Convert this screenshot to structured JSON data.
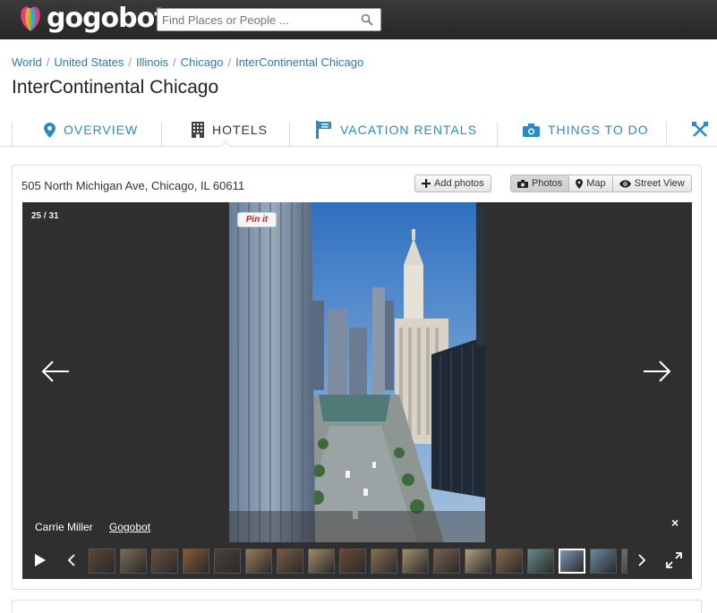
{
  "brand": {
    "name": "gogobot"
  },
  "search": {
    "placeholder": "Find Places or People ..."
  },
  "breadcrumb": [
    "World",
    "United States",
    "Illinois",
    "Chicago",
    "InterContinental Chicago"
  ],
  "page_title": "InterContinental Chicago",
  "tabs": [
    {
      "label": "OVERVIEW",
      "icon": "map-pin-icon",
      "active": false
    },
    {
      "label": "HOTELS",
      "icon": "building-icon",
      "active": true
    },
    {
      "label": "VACATION RENTALS",
      "icon": "flag-icon",
      "active": false
    },
    {
      "label": "THINGS TO DO",
      "icon": "camera-icon",
      "active": false
    }
  ],
  "listing": {
    "address": "505 North Michigan Ave, Chicago, IL 60611",
    "add_photos_label": "Add photos",
    "views": [
      "Photos",
      "Map",
      "Street View"
    ],
    "active_view": "Photos"
  },
  "gallery": {
    "counter": "25 / 31",
    "current": 25,
    "total": 31,
    "pin_label": "Pin it",
    "credit_author": "Carrie Miller",
    "credit_source": "Gogobot",
    "close_label": "×",
    "thumb_colors": [
      "#5a4636",
      "#7a6a55",
      "#6b5040",
      "#8a5a30",
      "#4a4038",
      "#9a7a58",
      "#7a5a40",
      "#a08a68",
      "#6a4a38",
      "#8a7050",
      "#a09070",
      "#7a6048",
      "#b0a080",
      "#8a6848",
      "#6a8a8a",
      "#7a96b8",
      "#6a8aa0",
      "#707070"
    ],
    "active_thumb": 15
  },
  "colors": {
    "link": "#2a7ab0",
    "tab": "#2a8ac8",
    "topbar": "#2e2e2e"
  }
}
